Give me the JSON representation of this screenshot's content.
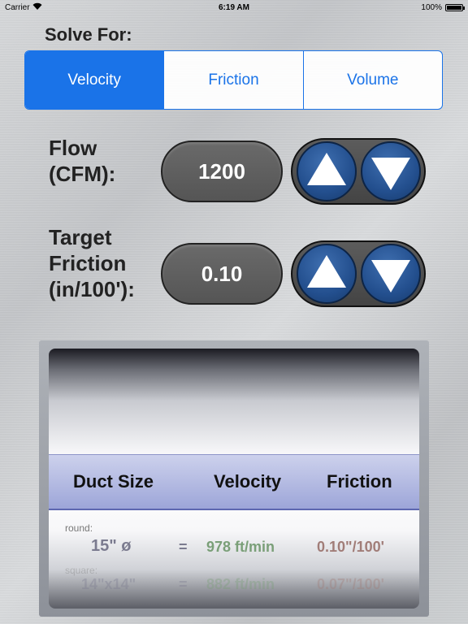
{
  "status": {
    "carrier": "Carrier",
    "time": "6:19 AM",
    "battery": "100%"
  },
  "solve": {
    "label": "Solve For:",
    "segments": [
      "Velocity",
      "Friction",
      "Volume"
    ],
    "selected": "Velocity"
  },
  "flow": {
    "label_line1": "Flow",
    "label_line2": "(CFM):",
    "value": "1200"
  },
  "friction": {
    "label_line1": "Target",
    "label_line2": "Friction",
    "label_line3": "(in/100'):",
    "value": "0.10"
  },
  "picker": {
    "headers": {
      "duct_size": "Duct Size",
      "velocity": "Velocity",
      "friction": "Friction"
    },
    "rows": [
      {
        "caption": "round:",
        "size": "15\" ø",
        "eq": "=",
        "velocity": "978 ft/min",
        "friction": "0.10\"/100'"
      },
      {
        "caption": "square:",
        "size": "14\"x14\"",
        "eq": "=",
        "velocity": "882 ft/min",
        "friction": "0.07\"/100'"
      }
    ]
  },
  "colors": {
    "accent": "#1a73e8",
    "velocity_text": "#7a9f78",
    "friction_text": "#a17d78",
    "size_text": "#7b7b8f"
  }
}
